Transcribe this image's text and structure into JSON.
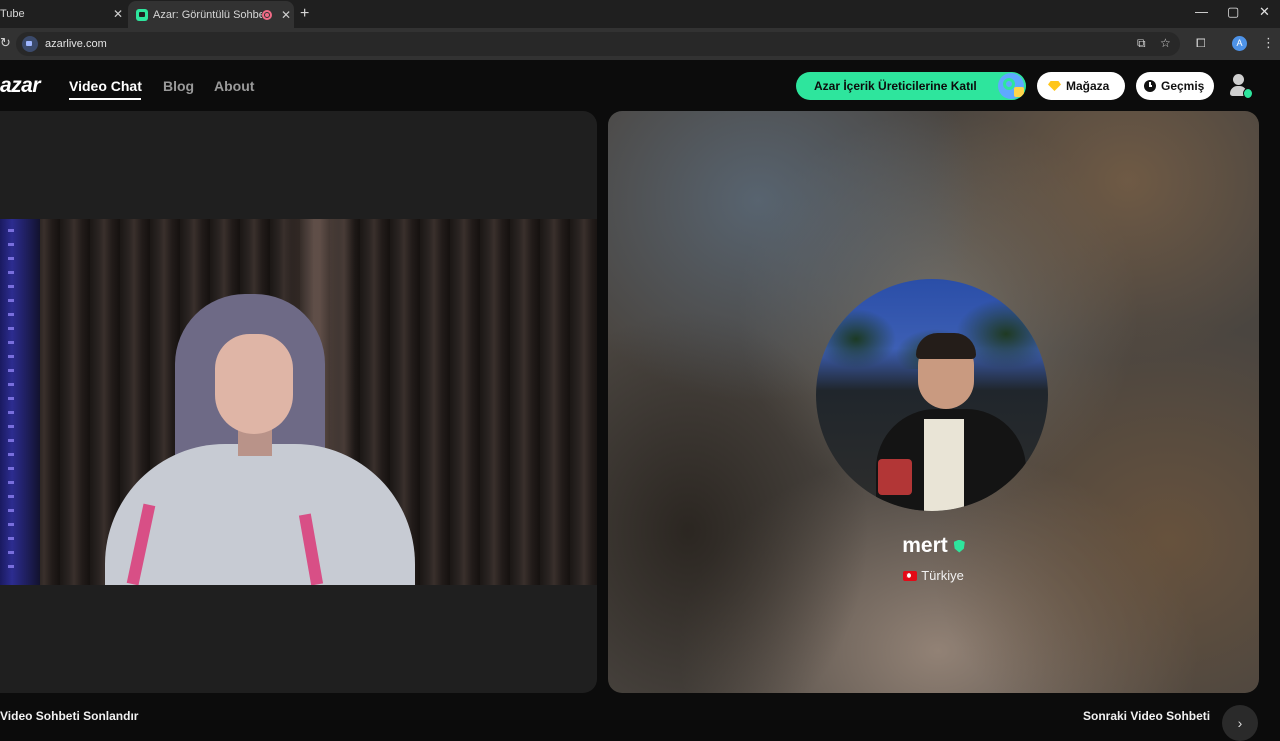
{
  "browser": {
    "tabs": [
      {
        "title": "Tube",
        "active": false
      },
      {
        "title": "Azar: Görüntülü Sohbet &",
        "active": true
      }
    ],
    "url": "azarlive.com",
    "profile_initial": "A",
    "icons": [
      "reload-icon",
      "site-info-icon",
      "install-app-icon",
      "bookmark-star-icon",
      "extensions-icon",
      "menu-icon",
      "new-tab-icon",
      "minimize-icon",
      "maximize-icon",
      "close-icon"
    ]
  },
  "site": {
    "logo": "azar",
    "nav": [
      {
        "label": "Video Chat",
        "active": true
      },
      {
        "label": "Blog",
        "active": false
      },
      {
        "label": "About",
        "active": false
      }
    ],
    "cta_label": "Azar İçerik Üreticilerine Katıl",
    "shop_label": "Mağaza",
    "history_label": "Geçmiş",
    "accent": "#2ee59d"
  },
  "partner": {
    "name": "mert",
    "country": "Türkiye",
    "verified": true
  },
  "footer": {
    "end_label": "Video Sohbeti Sonlandır",
    "next_label": "Sonraki Video Sohbeti"
  }
}
